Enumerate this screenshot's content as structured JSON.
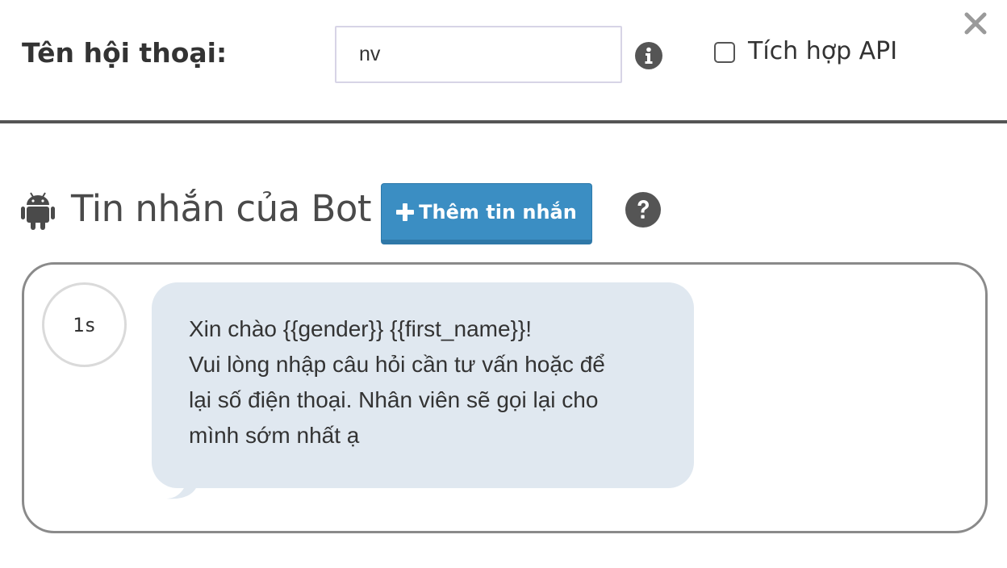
{
  "header": {
    "conversation_label": "Tên hội thoại:",
    "conversation_name_value": "nv",
    "info_icon": "info-circle-icon",
    "api_checkbox_checked": false,
    "api_label": "Tích hợp API",
    "close_icon": "close-icon"
  },
  "bot_messages": {
    "section_icon": "android-icon",
    "title": "Tin nhắn của Bot",
    "add_button_icon": "plus-icon",
    "add_button_label": "Thêm tin nhắn",
    "help_icon": "question-circle-icon",
    "messages": [
      {
        "delay": "1s",
        "lines": [
          "Xin chào {{gender}} {{first_name}}!",
          "Vui lòng nhập câu hỏi cần tư vấn hoặc để",
          "lại số điện thoại. Nhân viên sẽ gọi lại cho",
          "mình sớm nhất ạ"
        ]
      }
    ]
  },
  "colors": {
    "primary_button": "#3b8ec3",
    "bubble_background": "#e0e8f0",
    "text": "#333333",
    "icon_gray": "#555555",
    "divider": "#555555"
  }
}
